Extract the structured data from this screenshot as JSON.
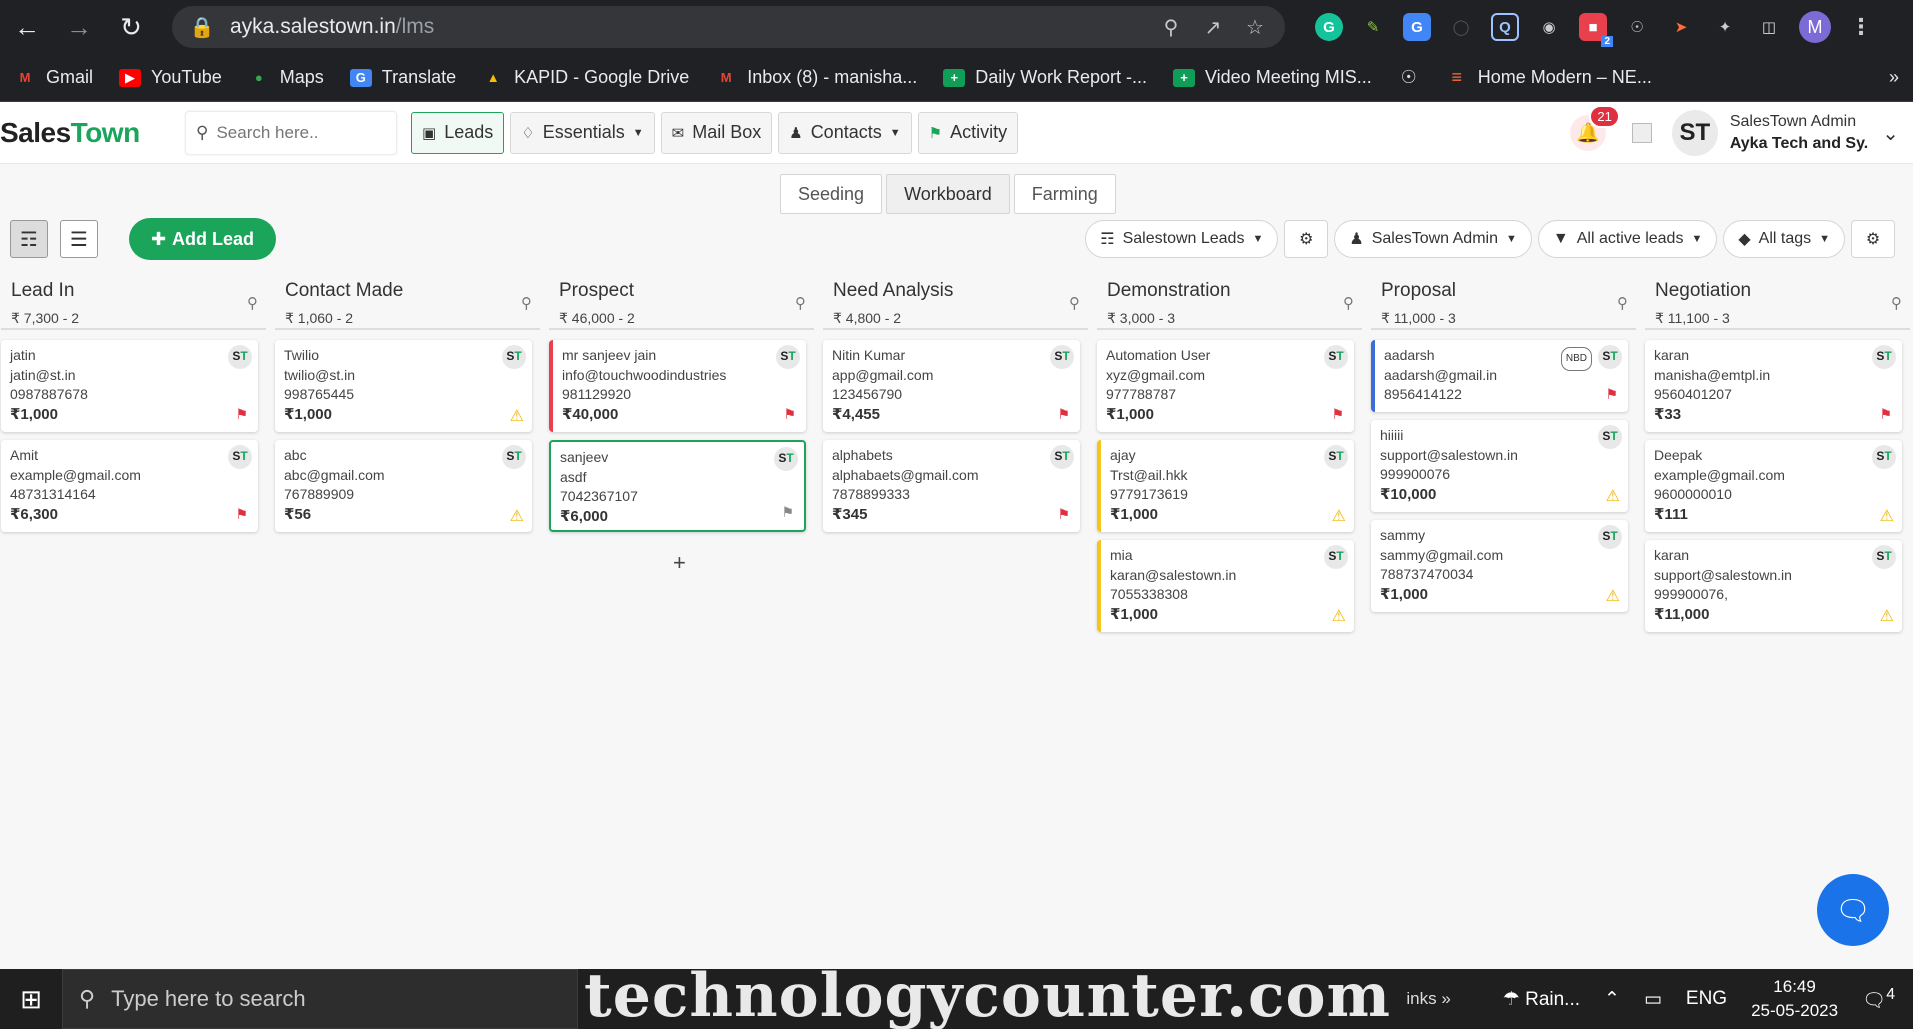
{
  "browser": {
    "url_host": "ayka.salestown.in",
    "url_path": "/lms",
    "profile_initial": "M",
    "ext_badge": "2"
  },
  "bookmarks": [
    {
      "label": "Gmail",
      "icon": "gmail-icon"
    },
    {
      "label": "YouTube",
      "icon": "youtube-icon"
    },
    {
      "label": "Maps",
      "icon": "maps-icon"
    },
    {
      "label": "Translate",
      "icon": "translate-icon"
    },
    {
      "label": "KAPID - Google Drive",
      "icon": "drive-icon"
    },
    {
      "label": "Inbox (8) - manisha...",
      "icon": "gmail-icon"
    },
    {
      "label": "Daily Work Report -...",
      "icon": "sheets-icon"
    },
    {
      "label": "Video Meeting MIS...",
      "icon": "sheets-icon"
    },
    {
      "label": "",
      "icon": "globe-icon"
    },
    {
      "label": "Home Modern – NE...",
      "icon": "stack-icon"
    }
  ],
  "header": {
    "logo_sales": "Sales",
    "logo_town": "Town",
    "search_placeholder": "Search here..",
    "nav": {
      "leads": "Leads",
      "essentials": "Essentials",
      "mailbox": "Mail Box",
      "contacts": "Contacts",
      "activity": "Activity"
    },
    "notifications": "21",
    "avatar": "ST",
    "user_name": "SalesTown Admin",
    "user_org": "Ayka Tech and Sy."
  },
  "view_tabs": {
    "seeding": "Seeding",
    "workboard": "Workboard",
    "farming": "Farming"
  },
  "toolbar": {
    "add_lead": "Add Lead",
    "pipeline": "Salestown Leads",
    "owner": "SalesTown Admin",
    "status_filter": "All active leads",
    "tags_filter": "All tags"
  },
  "columns": [
    {
      "title": "Lead In",
      "meta": "₹ 7,300 - 2",
      "cards": [
        {
          "name": "jatin",
          "email": "jatin@st.in",
          "phone": "0987887678",
          "amount": "₹1,000",
          "marker": "flag"
        },
        {
          "name": "Amit",
          "email": "example@gmail.com",
          "phone": "48731314164",
          "amount": "₹6,300",
          "marker": "flag"
        }
      ]
    },
    {
      "title": "Contact Made",
      "meta": "₹ 1,060 - 2",
      "cards": [
        {
          "name": "Twilio",
          "email": "twilio@st.in",
          "phone": "998765445",
          "amount": "₹1,000",
          "marker": "warn"
        },
        {
          "name": "abc",
          "email": "abc@gmail.com",
          "phone": "767889909",
          "amount": "₹56",
          "marker": "warn"
        }
      ]
    },
    {
      "title": "Prospect",
      "meta": "₹ 46,000 - 2",
      "cards": [
        {
          "name": "mr sanjeev jain",
          "email": "info@touchwoodindustries",
          "phone": "981129920",
          "amount": "₹40,000",
          "marker": "flag",
          "accent": "red"
        },
        {
          "name": "sanjeev",
          "email": "asdf",
          "phone": "7042367107",
          "amount": "₹6,000",
          "marker": "flag-grey",
          "accent": "green"
        }
      ]
    },
    {
      "title": "Need Analysis",
      "meta": "₹ 4,800 - 2",
      "cards": [
        {
          "name": "Nitin Kumar",
          "email": "app@gmail.com",
          "phone": "123456790",
          "amount": "₹4,455",
          "marker": "flag"
        },
        {
          "name": "alphabets",
          "email": "alphabaets@gmail.com",
          "phone": "7878899333",
          "amount": "₹345",
          "marker": "flag"
        }
      ]
    },
    {
      "title": "Demonstration",
      "meta": "₹ 3,000 - 3",
      "cards": [
        {
          "name": "Automation User",
          "email": "xyz@gmail.com",
          "phone": "977788787",
          "amount": "₹1,000",
          "marker": "flag"
        },
        {
          "name": "ajay",
          "email": "Trst@ail.hkk",
          "phone": "9779173619",
          "amount": "₹1,000",
          "marker": "warn",
          "accent": "yellow"
        },
        {
          "name": "mia",
          "email": "karan@salestown.in",
          "phone": "7055338308",
          "amount": "₹1,000",
          "marker": "warn",
          "accent": "yellow"
        }
      ]
    },
    {
      "title": "Proposal",
      "meta": "₹ 11,000 - 3",
      "cards": [
        {
          "name": "aadarsh",
          "email": "aadarsh@gmail.in",
          "phone": "8956414122",
          "amount": "",
          "marker": "flag",
          "accent": "blue",
          "tag": "NBD"
        },
        {
          "name": "hiiiii",
          "email": "support@salestown.in",
          "phone": "999900076",
          "amount": "₹10,000",
          "marker": "warn"
        },
        {
          "name": "sammy",
          "email": "sammy@gmail.com",
          "phone": "788737470034",
          "amount": "₹1,000",
          "marker": "warn"
        }
      ]
    },
    {
      "title": "Negotiation",
      "meta": "₹ 11,100 - 3",
      "cards": [
        {
          "name": "karan",
          "email": "manisha@emtpl.in",
          "phone": "9560401207",
          "amount": "₹33",
          "marker": "flag"
        },
        {
          "name": "Deepak",
          "email": "example@gmail.com",
          "phone": "9600000010",
          "amount": "₹111",
          "marker": "warn"
        },
        {
          "name": "karan",
          "email": "support@salestown.in",
          "phone": "999900076,",
          "amount": "₹11,000",
          "marker": "warn"
        }
      ]
    }
  ],
  "card_badge_s": "S",
  "card_badge_t": "T",
  "taskbar": {
    "search_placeholder": "Type here to search",
    "watermark": "technologycounter.com",
    "links": "inks",
    "weather": "Rain...",
    "lang": "ENG",
    "time": "16:49",
    "date": "25-05-2023",
    "notif_count": "4"
  }
}
